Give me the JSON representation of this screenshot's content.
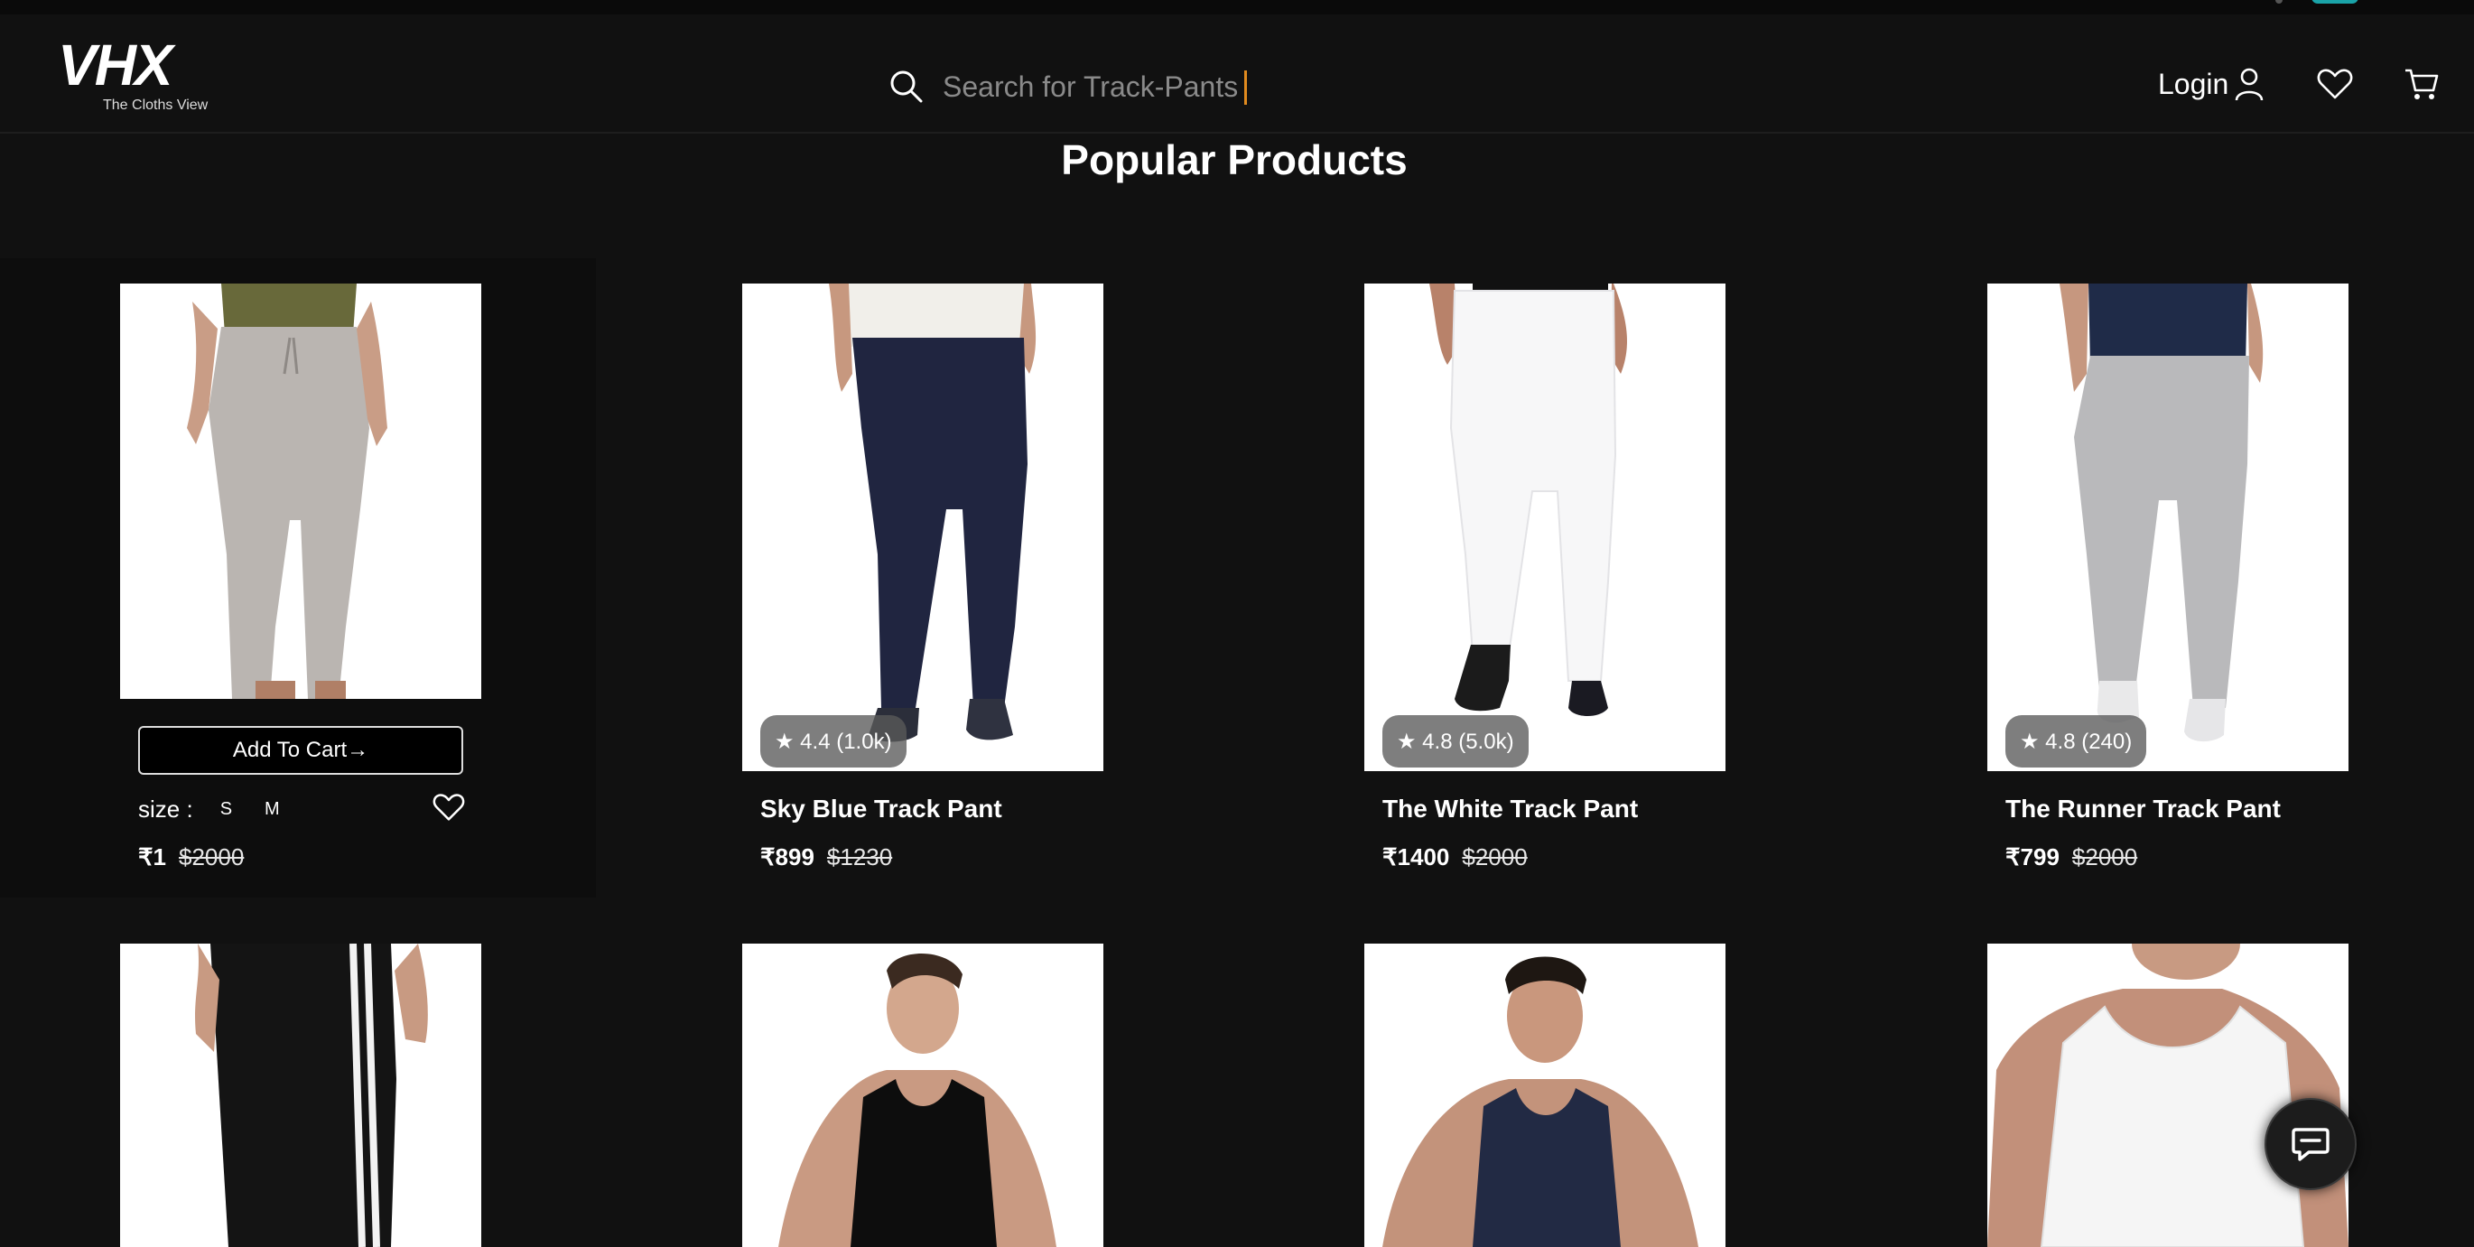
{
  "header": {
    "logo_text": "VHX",
    "logo_subtitle": "The Cloths View",
    "search_placeholder": "Search for Track-Pants",
    "login_label": "Login"
  },
  "heading": "Popular Products",
  "product_hovered": {
    "add_to_cart_label": "Add To Cart→",
    "size_label": "size :",
    "sizes": [
      "S",
      "M"
    ],
    "price": "₹1",
    "original_price": "$2000"
  },
  "products": [
    {
      "name": "Sky Blue Track Pant",
      "rating": "★ 4.4 (1.0k)",
      "price": "₹899",
      "original_price": "$1230"
    },
    {
      "name": "The White Track Pant",
      "rating": "★ 4.8 (5.0k)",
      "price": "₹1400",
      "original_price": "$2000"
    },
    {
      "name": "The Runner Track Pant",
      "rating": "★ 4.8 (240)",
      "price": "₹799",
      "original_price": "$2000"
    }
  ],
  "colors": {
    "background": "#111111",
    "card_image_bg": "#ffffff",
    "accent_caret": "#e08a1e",
    "rating_badge": "#5a5a5a"
  },
  "icons": [
    "search-icon",
    "user-icon",
    "heart-icon",
    "cart-icon",
    "chat-icon"
  ]
}
